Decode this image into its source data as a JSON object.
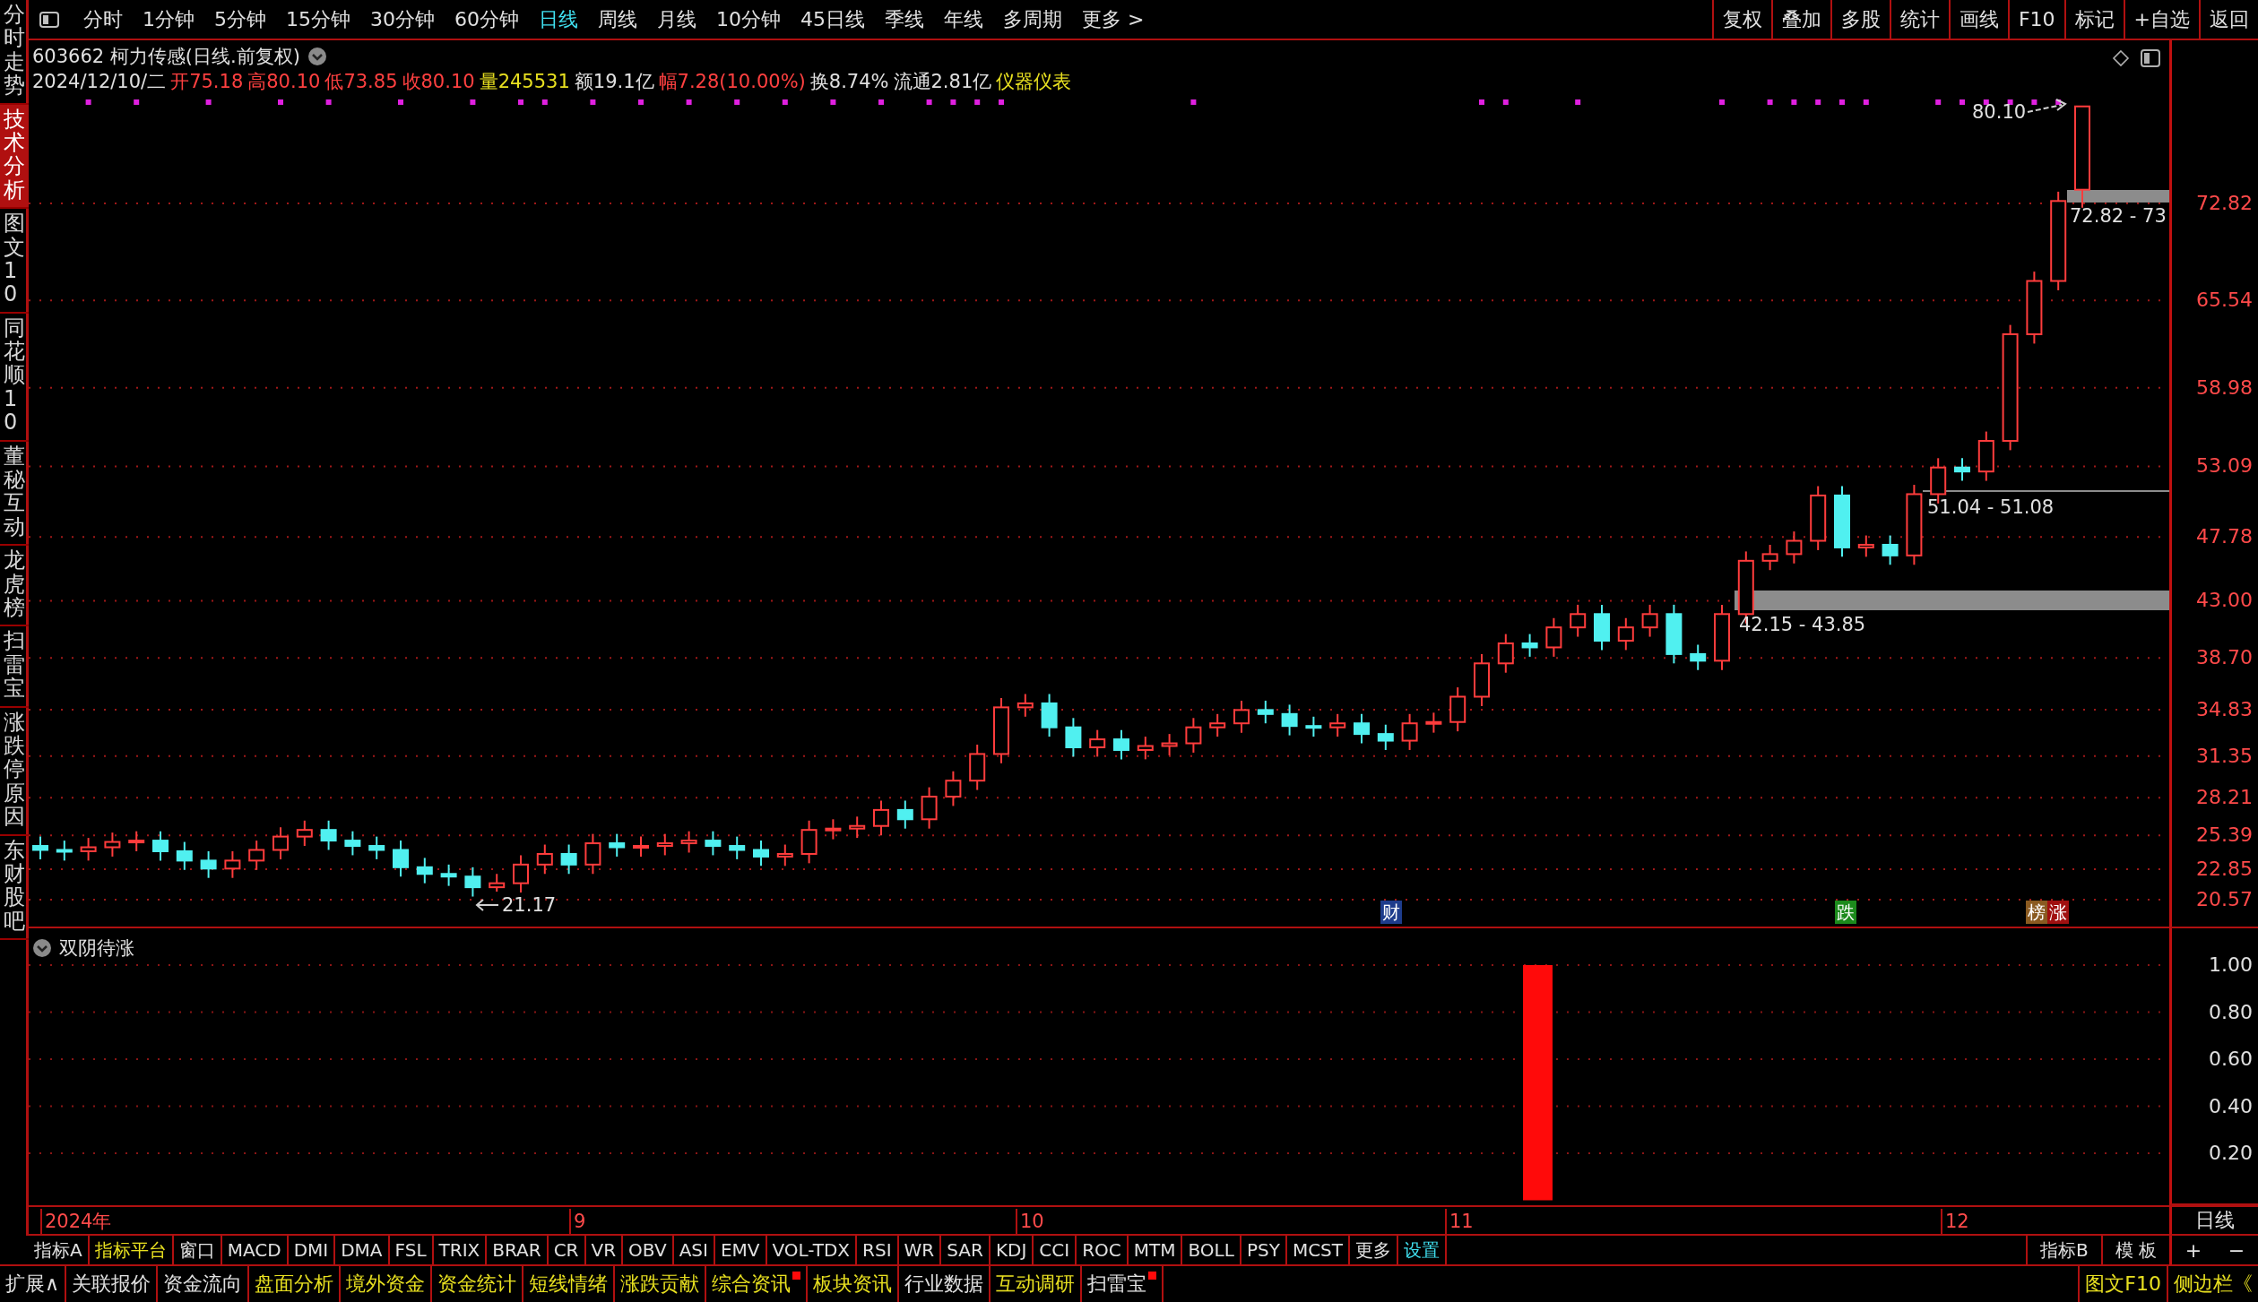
{
  "toolbar": {
    "periods": [
      {
        "label": "分时",
        "selected": false
      },
      {
        "label": "1分钟",
        "selected": false
      },
      {
        "label": "5分钟",
        "selected": false
      },
      {
        "label": "15分钟",
        "selected": false
      },
      {
        "label": "30分钟",
        "selected": false
      },
      {
        "label": "60分钟",
        "selected": false
      },
      {
        "label": "日线",
        "selected": true
      },
      {
        "label": "周线",
        "selected": false
      },
      {
        "label": "月线",
        "selected": false
      },
      {
        "label": "10分钟",
        "selected": false
      },
      {
        "label": "45日线",
        "selected": false
      },
      {
        "label": "季线",
        "selected": false
      },
      {
        "label": "年线",
        "selected": false
      },
      {
        "label": "多周期",
        "selected": false
      },
      {
        "label": "更多 >",
        "selected": false
      }
    ],
    "actions": [
      "复权",
      "叠加",
      "多股",
      "统计",
      "画线",
      "F10",
      "标记",
      "+自选",
      "返回"
    ]
  },
  "sidebar": {
    "items": [
      {
        "label": "分时走势",
        "selected": false
      },
      {
        "label": "技术分析",
        "selected": true
      },
      {
        "label": "图文10",
        "selected": false
      },
      {
        "label": "同花顺10",
        "selected": false
      },
      {
        "label": "董秘互动",
        "selected": false
      },
      {
        "label": "龙虎榜",
        "selected": false
      },
      {
        "label": "扫雷宝",
        "selected": false
      },
      {
        "label": "涨跌停原因",
        "selected": false
      },
      {
        "label": "东财股吧",
        "selected": false
      }
    ]
  },
  "quote": {
    "title": "603662 柯力传感(日线.前复权)",
    "fields": [
      {
        "text": "2024/12/10/二",
        "kind": "plain"
      },
      {
        "text": "开75.18",
        "kind": "rise"
      },
      {
        "text": "高80.10",
        "kind": "rise"
      },
      {
        "text": "低73.85",
        "kind": "rise"
      },
      {
        "text": "收80.10",
        "kind": "rise"
      },
      {
        "text": "量245531",
        "kind": "volume"
      },
      {
        "text": "额19.1亿",
        "kind": "plain"
      },
      {
        "text": "幅7.28(10.00%)",
        "kind": "rise"
      },
      {
        "text": "换8.74%",
        "kind": "plain"
      },
      {
        "text": "流通2.81亿",
        "kind": "plain"
      },
      {
        "text": "仪器仪表",
        "kind": "industry"
      }
    ]
  },
  "price_chart": {
    "price_axis": [
      "72.82",
      "65.54",
      "58.98",
      "53.09",
      "47.78",
      "43.00",
      "38.70",
      "34.83",
      "31.35",
      "28.21",
      "25.39",
      "22.85",
      "20.57"
    ],
    "annotations": [
      {
        "kind": "high",
        "text": "80.10"
      },
      {
        "kind": "range_top",
        "text": "72.82 - 73"
      },
      {
        "kind": "range_mid",
        "text": "51.04 - 51.08"
      },
      {
        "kind": "range_low",
        "text": "42.15 - 43.85"
      },
      {
        "kind": "low",
        "text": "21.17"
      }
    ],
    "markers": [
      {
        "text": "财",
        "color": "#1e3c8c"
      },
      {
        "text": "跌",
        "color": "#1c8a1c"
      },
      {
        "text": "榜",
        "color": "#8a5a20"
      },
      {
        "text": "涨",
        "color": "#a01010"
      }
    ]
  },
  "indicator": {
    "title": "双阴待涨",
    "axis": [
      "1.00",
      "0.80",
      "0.60",
      "0.40",
      "0.20"
    ]
  },
  "date_axis": {
    "labels": [
      "2024年",
      "9",
      "10",
      "11",
      "12"
    ],
    "period": "日线"
  },
  "indicator_tabs": {
    "items": [
      {
        "label": "指标A",
        "kind": "plain"
      },
      {
        "label": "指标平台",
        "kind": "feature"
      },
      {
        "label": "窗口",
        "kind": "plain"
      },
      {
        "label": "MACD",
        "kind": "plain"
      },
      {
        "label": "DMI",
        "kind": "plain"
      },
      {
        "label": "DMA",
        "kind": "plain"
      },
      {
        "label": "FSL",
        "kind": "plain"
      },
      {
        "label": "TRIX",
        "kind": "plain"
      },
      {
        "label": "BRAR",
        "kind": "plain"
      },
      {
        "label": "CR",
        "kind": "plain"
      },
      {
        "label": "VR",
        "kind": "plain"
      },
      {
        "label": "OBV",
        "kind": "plain"
      },
      {
        "label": "ASI",
        "kind": "plain"
      },
      {
        "label": "EMV",
        "kind": "plain"
      },
      {
        "label": "VOL-TDX",
        "kind": "plain"
      },
      {
        "label": "RSI",
        "kind": "plain"
      },
      {
        "label": "WR",
        "kind": "plain"
      },
      {
        "label": "SAR",
        "kind": "plain"
      },
      {
        "label": "KDJ",
        "kind": "plain"
      },
      {
        "label": "CCI",
        "kind": "plain"
      },
      {
        "label": "ROC",
        "kind": "plain"
      },
      {
        "label": "MTM",
        "kind": "plain"
      },
      {
        "label": "BOLL",
        "kind": "plain"
      },
      {
        "label": "PSY",
        "kind": "plain"
      },
      {
        "label": "MCST",
        "kind": "plain"
      },
      {
        "label": "更多",
        "kind": "plain"
      },
      {
        "label": "设置",
        "kind": "setting"
      }
    ],
    "right": [
      "指标B",
      "模 板"
    ],
    "zoom": [
      "+",
      "−"
    ]
  },
  "bottom_bar": {
    "items": [
      {
        "label": "扩展∧",
        "kind": "plain",
        "badge": false
      },
      {
        "label": "关联报价",
        "kind": "plain",
        "badge": false
      },
      {
        "label": "资金流向",
        "kind": "plain",
        "badge": false
      },
      {
        "label": "盘面分析",
        "kind": "feature",
        "badge": false
      },
      {
        "label": "境外资金",
        "kind": "feature",
        "badge": false
      },
      {
        "label": "资金统计",
        "kind": "feature",
        "badge": false
      },
      {
        "label": "短线情绪",
        "kind": "feature",
        "badge": false
      },
      {
        "label": "涨跌贡献",
        "kind": "feature",
        "badge": false
      },
      {
        "label": "综合资讯",
        "kind": "feature",
        "badge": true
      },
      {
        "label": "板块资讯",
        "kind": "feature",
        "badge": false
      },
      {
        "label": "行业数据",
        "kind": "plain",
        "badge": false
      },
      {
        "label": "互动调研",
        "kind": "feature",
        "badge": false
      },
      {
        "label": "扫雷宝",
        "kind": "plain",
        "badge": true
      }
    ],
    "right": [
      "图文F10",
      "侧边栏《"
    ]
  }
}
